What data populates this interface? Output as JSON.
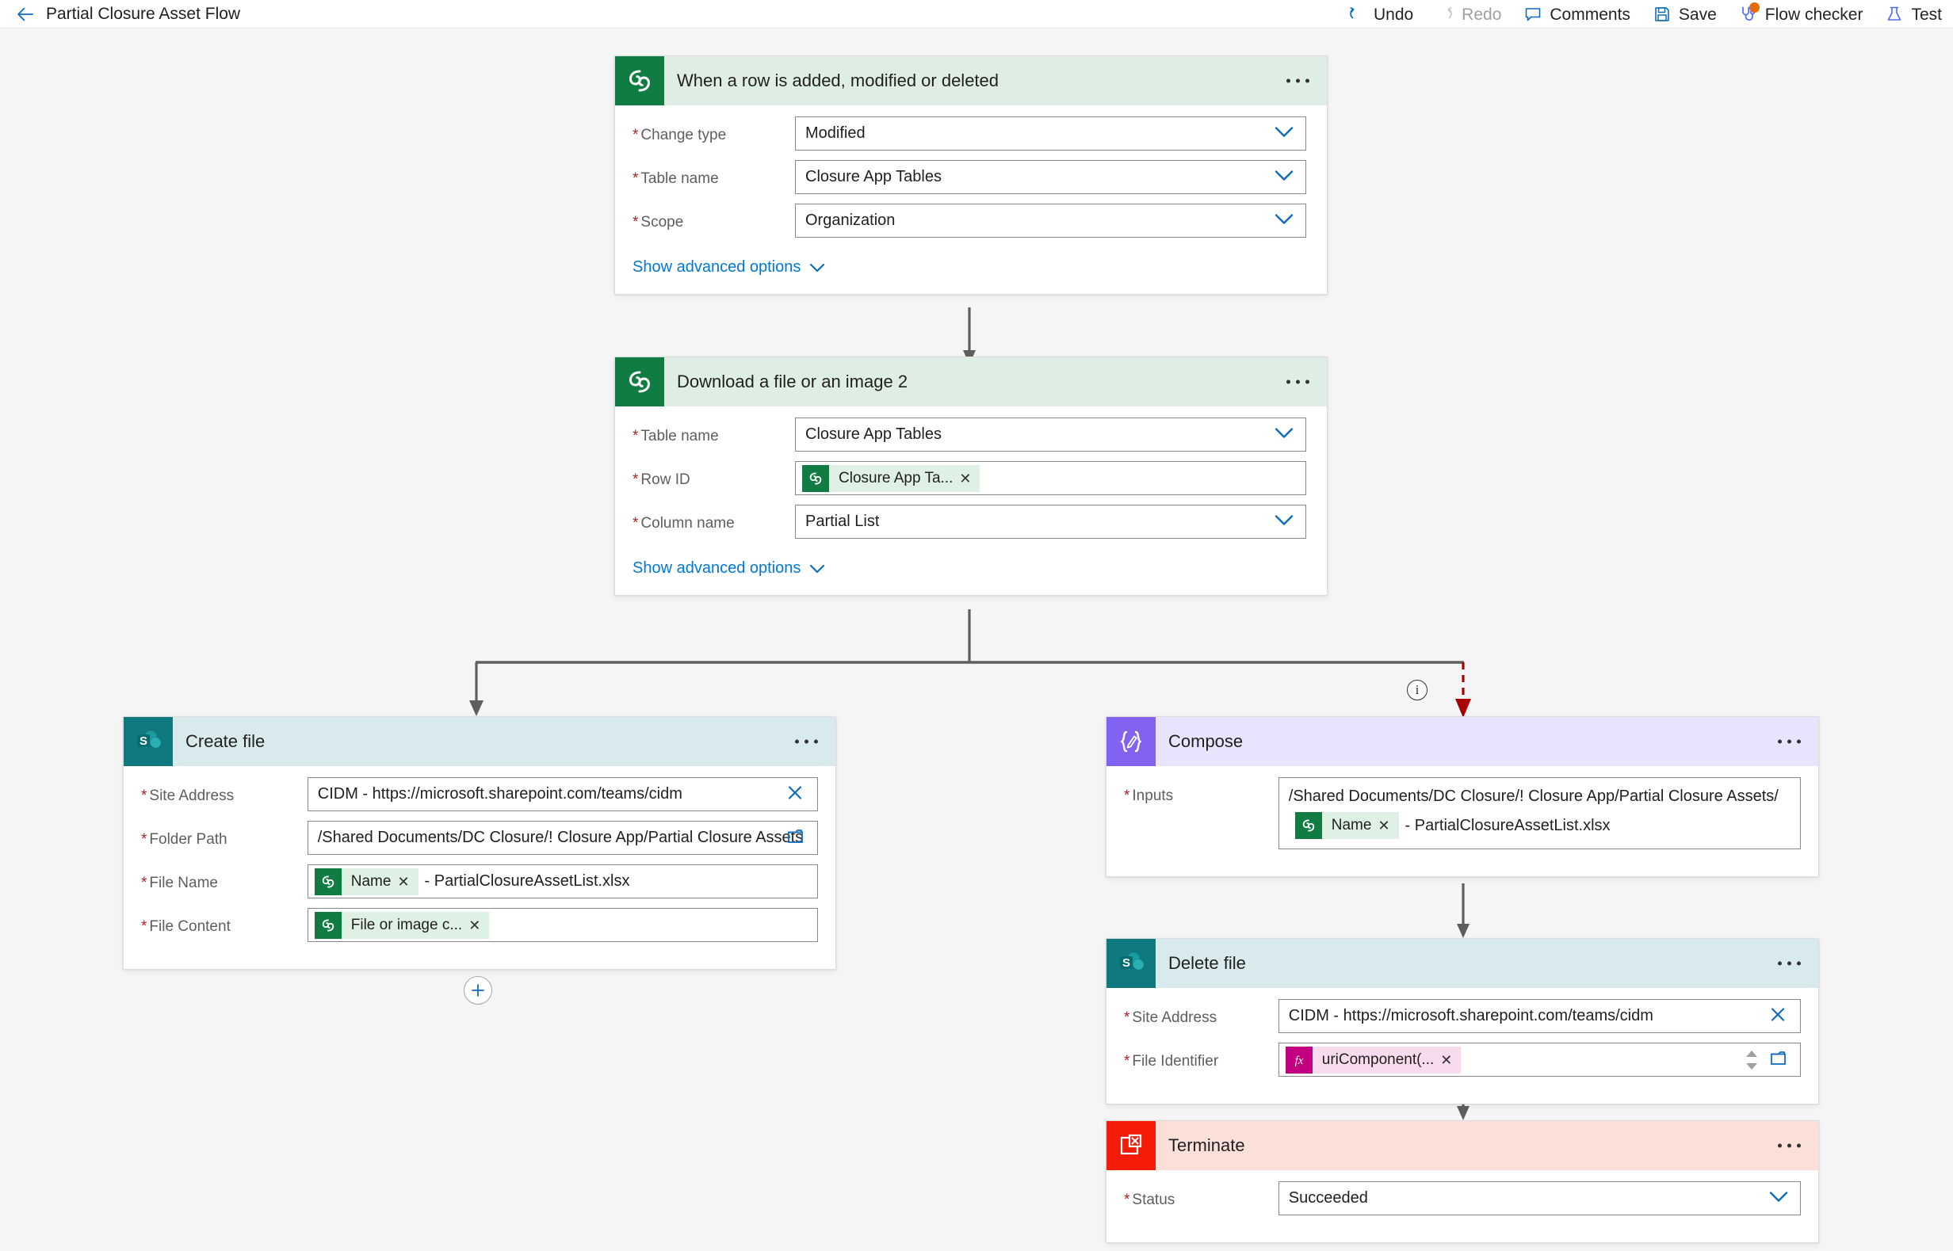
{
  "header": {
    "back_icon": "back-arrow-icon",
    "title": "Partial Closure Asset Flow",
    "toolbar": [
      {
        "id": "undo",
        "label": "Undo",
        "icon": "undo-icon",
        "disabled": false,
        "badge": false
      },
      {
        "id": "redo",
        "label": "Redo",
        "icon": "redo-icon",
        "disabled": true,
        "badge": false
      },
      {
        "id": "comments",
        "label": "Comments",
        "icon": "comment-icon",
        "disabled": false,
        "badge": false
      },
      {
        "id": "save",
        "label": "Save",
        "icon": "save-disk-icon",
        "disabled": false,
        "badge": false
      },
      {
        "id": "flow-checker",
        "label": "Flow checker",
        "icon": "stethoscope-icon",
        "disabled": false,
        "badge": true
      },
      {
        "id": "test",
        "label": "Test",
        "icon": "flask-icon",
        "disabled": false,
        "badge": false
      }
    ]
  },
  "colors": {
    "dataverse_green": "#107c41",
    "dataverse_header": "#dfeee5",
    "sharepoint_teal": "#10797f",
    "sharepoint_header": "#d9eaec",
    "compose_purple": "#8262f0",
    "compose_header": "#e9e4fd",
    "terminate_red": "#f41b08",
    "terminate_header": "#fbdfd9",
    "accent_blue": "#0078d4",
    "required_red": "#a4262c",
    "error_red": "#a80000",
    "badge_orange": "#e8690b"
  },
  "cards": {
    "trigger": {
      "title": "When a row is added, modified or deleted",
      "icon": "dataverse-icon",
      "advanced_label": "Show advanced options",
      "fields": [
        {
          "label": "Change type",
          "required": true,
          "value": "Modified",
          "control": "dropdown"
        },
        {
          "label": "Table name",
          "required": true,
          "value": "Closure App Tables",
          "control": "dropdown"
        },
        {
          "label": "Scope",
          "required": true,
          "value": "Organization",
          "control": "dropdown"
        }
      ]
    },
    "download": {
      "title": "Download a file or an image 2",
      "icon": "dataverse-icon",
      "advanced_label": "Show advanced options",
      "fields": [
        {
          "label": "Table name",
          "required": true,
          "value": "Closure App Tables",
          "control": "dropdown"
        },
        {
          "label": "Row ID",
          "required": true,
          "control": "token",
          "token": "Closure App Ta...",
          "token_icon": "dataverse-icon"
        },
        {
          "label": "Column name",
          "required": true,
          "value": "Partial List",
          "control": "dropdown"
        }
      ]
    },
    "create_file": {
      "title": "Create file",
      "icon": "sharepoint-icon",
      "fields": [
        {
          "label": "Site Address",
          "required": true,
          "value": "CIDM - https://microsoft.sharepoint.com/teams/cidm",
          "control": "clear"
        },
        {
          "label": "Folder Path",
          "required": true,
          "value": "/Shared Documents/DC Closure/! Closure App/Partial Closure Assets",
          "control": "folder"
        },
        {
          "label": "File Name",
          "required": true,
          "control": "token",
          "token": "Name",
          "token_icon": "dataverse-icon",
          "suffix": "- PartialClosureAssetList.xlsx"
        },
        {
          "label": "File Content",
          "required": true,
          "control": "token",
          "token": "File or image c...",
          "token_icon": "dataverse-icon"
        }
      ]
    },
    "compose": {
      "title": "Compose",
      "icon": "compose-icon",
      "fields": [
        {
          "label": "Inputs",
          "required": true,
          "control": "multiline",
          "line1": "/Shared Documents/DC Closure/! Closure App/Partial Closure Assets/",
          "token": "Name",
          "token_icon": "dataverse-icon",
          "suffix": "- PartialClosureAssetList.xlsx"
        }
      ]
    },
    "delete_file": {
      "title": "Delete file",
      "icon": "sharepoint-icon",
      "fields": [
        {
          "label": "Site Address",
          "required": true,
          "value": "CIDM - https://microsoft.sharepoint.com/teams/cidm",
          "control": "clear"
        },
        {
          "label": "File Identifier",
          "required": true,
          "control": "token-fx",
          "token": "uriComponent(...",
          "token_icon": "function-fx-icon"
        }
      ]
    },
    "terminate": {
      "title": "Terminate",
      "icon": "terminate-icon",
      "fields": [
        {
          "label": "Status",
          "required": true,
          "value": "Succeeded",
          "control": "dropdown"
        }
      ]
    }
  },
  "connectors": {
    "add_step_icon": "plus-icon",
    "info_icon": "info-icon",
    "error_branch_color": "#a80000"
  }
}
